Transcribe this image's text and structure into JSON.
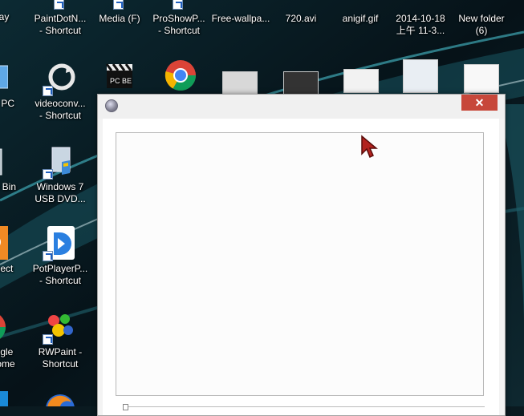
{
  "desktop": {
    "icons": [
      {
        "id": "ay",
        "label": "ay"
      },
      {
        "id": "paintdotnet",
        "label": "PaintDotN...\n- Shortcut"
      },
      {
        "id": "media",
        "label": "Media (F)"
      },
      {
        "id": "proshow",
        "label": "ProShowP...\n- Shortcut"
      },
      {
        "id": "wallpaper",
        "label": "Free-wallpa..."
      },
      {
        "id": "avi",
        "label": "720.avi"
      },
      {
        "id": "anigif",
        "label": "anigif.gif"
      },
      {
        "id": "date",
        "label": "2014-10-18\n上午 11-3..."
      },
      {
        "id": "newfolder",
        "label": "New folder\n(6)"
      },
      {
        "id": "thispc",
        "label": "s PC"
      },
      {
        "id": "videoconv",
        "label": "videoconv...\n- Shortcut"
      },
      {
        "id": "recycle",
        "label": "le Bin"
      },
      {
        "id": "win7usb",
        "label": "Windows 7\nUSB DVD..."
      },
      {
        "id": "connect",
        "label": "nect"
      },
      {
        "id": "potplayer",
        "label": "PotPlayerP...\n- Shortcut"
      },
      {
        "id": "chrome",
        "label": "ogle\nrome"
      },
      {
        "id": "rwpaint",
        "label": "RWPaint -\nShortcut"
      }
    ]
  },
  "dialog": {
    "close_label": "✕"
  },
  "colors": {
    "close_button": "#c7473a",
    "dialog_bg": "#ffffff"
  }
}
